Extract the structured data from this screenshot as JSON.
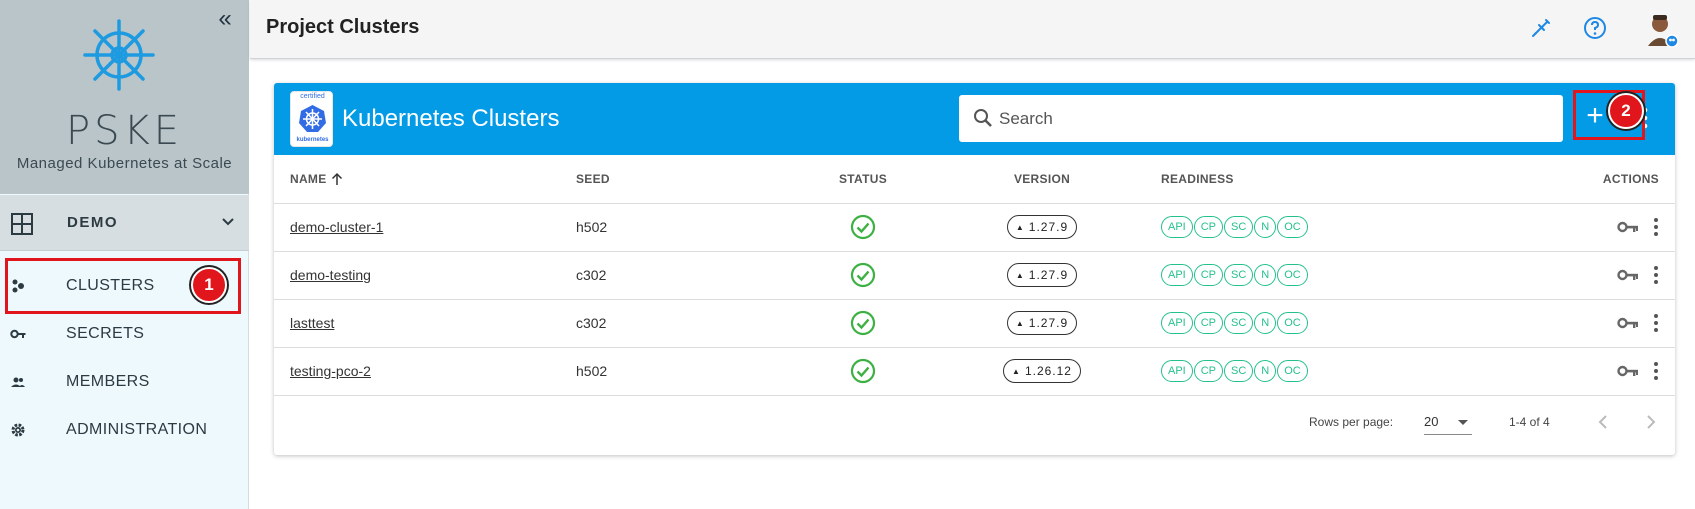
{
  "sidebar": {
    "brand_title": "PSKE",
    "brand_subtitle": "Managed Kubernetes at Scale",
    "collapse_glyph": "«",
    "project": "DEMO",
    "items": [
      {
        "label": "CLUSTERS",
        "icon": "clusters-icon"
      },
      {
        "label": "SECRETS",
        "icon": "key-icon"
      },
      {
        "label": "MEMBERS",
        "icon": "members-icon"
      },
      {
        "label": "ADMINISTRATION",
        "icon": "gear-icon"
      }
    ]
  },
  "topbar": {
    "title": "Project Clusters",
    "icons": [
      "plug-icon",
      "help-icon",
      "avatar"
    ]
  },
  "card": {
    "title": "Kubernetes Clusters",
    "badge_top": "certified",
    "badge_bottom": "kubernetes",
    "search_placeholder": "Search",
    "add_glyph": "+"
  },
  "table": {
    "columns": {
      "name": "NAME",
      "seed": "SEED",
      "status": "STATUS",
      "version": "VERSION",
      "readiness": "READINESS",
      "actions": "ACTIONS"
    },
    "readiness_labels": [
      "API",
      "CP",
      "SC",
      "N",
      "OC"
    ],
    "rows": [
      {
        "name": "demo-cluster-1",
        "seed": "h502",
        "status": "ready",
        "version": "1.27.9"
      },
      {
        "name": "demo-testing",
        "seed": "c302",
        "status": "ready",
        "version": "1.27.9"
      },
      {
        "name": "lasttest",
        "seed": "c302",
        "status": "ready",
        "version": "1.27.9"
      },
      {
        "name": "testing-pco-2",
        "seed": "h502",
        "status": "ready",
        "version": "1.26.12"
      }
    ]
  },
  "footer": {
    "rows_per_page_label": "Rows per page:",
    "rows_per_page_value": "20",
    "range": "1-4 of 4"
  },
  "annotations": {
    "step1": "1",
    "step2": "2"
  },
  "colors": {
    "header_blue": "#039be5",
    "sidebar_bg": "#eef9fd",
    "brand_bg": "#b9c5c9",
    "ready_green": "#25c18a",
    "highlight_red": "#e0161c"
  }
}
